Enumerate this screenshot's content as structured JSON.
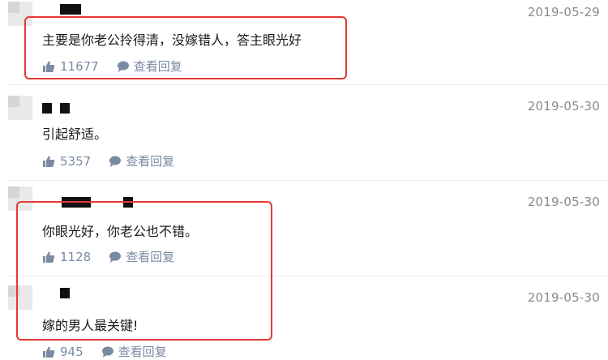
{
  "comments": [
    {
      "date": "2019-05-29",
      "text": "主要是你老公拎得清，没嫁错人，答主眼光好",
      "likes": "11677",
      "reply_label": "查看回复"
    },
    {
      "date": "2019-05-30",
      "text": "引起舒适。",
      "likes": "5357",
      "reply_label": "查看回复"
    },
    {
      "date": "2019-05-30",
      "text": "你眼光好，你老公也不错。",
      "likes": "1128",
      "reply_label": "查看回复"
    },
    {
      "date": "2019-05-30",
      "text": "嫁的男人最关键!",
      "likes": "945",
      "reply_label": "查看回复"
    }
  ],
  "colors": {
    "highlight": "#e53935",
    "action": "#7b8aa3",
    "date": "#8a8a8a"
  },
  "icons": {
    "like": "thumbs-up-icon",
    "reply": "speech-bubble-icon"
  }
}
